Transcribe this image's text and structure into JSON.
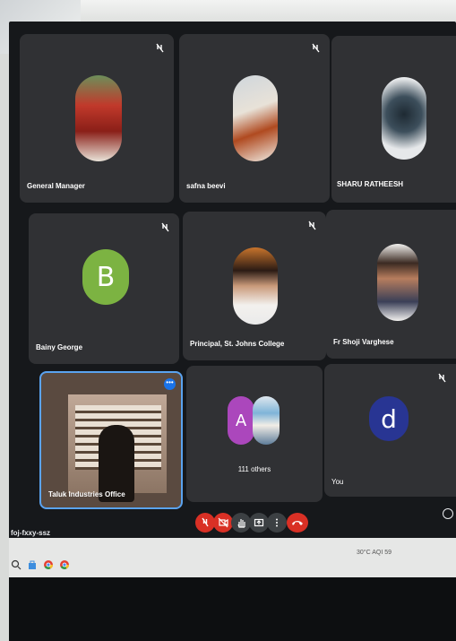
{
  "participants": [
    {
      "name": "General Manager",
      "muted": true,
      "avatar": "building-photo"
    },
    {
      "name": "safna beevi",
      "muted": true,
      "avatar": "person-photo"
    },
    {
      "name": "SHARU RATHEESH",
      "muted": false,
      "avatar": "dancer-emblem"
    },
    {
      "name": "Bainy George",
      "muted": true,
      "avatar_letter": "B",
      "avatar_color": "#7cb342"
    },
    {
      "name": "Principal, St. Johns College",
      "muted": true,
      "avatar": "person-photo"
    },
    {
      "name": "Fr Shoji Varghese",
      "muted": false,
      "avatar": "person-photo"
    },
    {
      "name": "Taluk Industries Office",
      "muted": false,
      "video": true,
      "active_speaker": true
    },
    {
      "name": "111 others",
      "avatar_letter": "A",
      "avatar_color": "#ab47bc"
    },
    {
      "name": "You",
      "muted": true,
      "avatar_letter": "d",
      "avatar_color": "#283593"
    }
  ],
  "meeting": {
    "code": "foj-fxxy-ssz"
  },
  "controls": [
    "mic-off-icon",
    "camera-off-icon",
    "raise-hand-icon",
    "present-icon",
    "more-options-icon",
    "end-call-icon"
  ],
  "taskbar": {
    "tray_text": "30°C AQI 59"
  },
  "colors": {
    "accent_blue": "#1a73e8",
    "end_call_red": "#d93025",
    "tile_bg": "#303134"
  }
}
